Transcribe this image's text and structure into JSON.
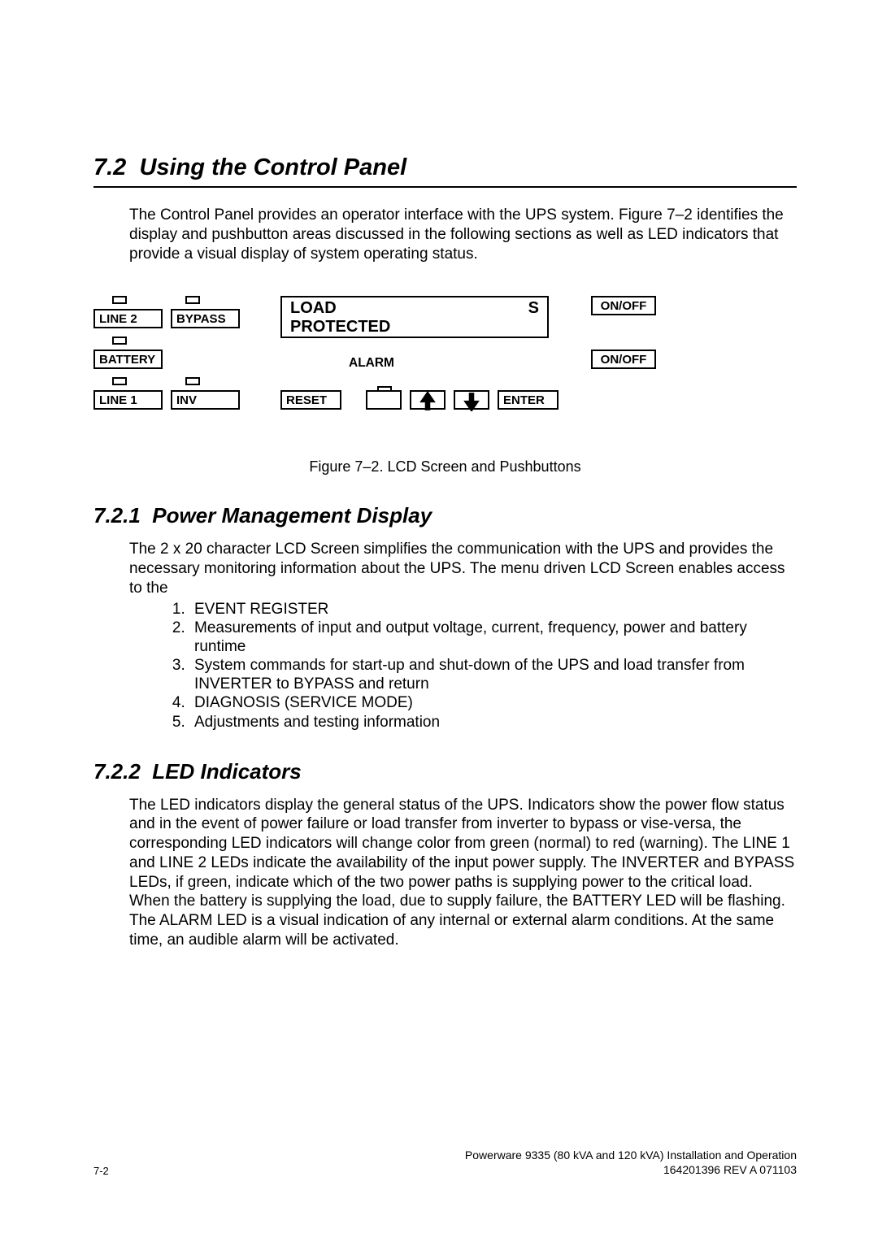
{
  "section_number": "7.2",
  "section_title": "Using the Control Panel",
  "intro": "The Control Panel provides an operator interface with the UPS system.  Figure 7–2 identifies the display and pushbutton areas discussed in the following sections as well as LED indicators that provide a visual display of system operating status.",
  "panel": {
    "line2": "LINE 2",
    "bypass": "BYPASS",
    "battery": "BATTERY",
    "line1": "LINE 1",
    "inv": "INV",
    "lcd_line1_left": "LOAD",
    "lcd_line1_right": "S",
    "lcd_line2": "PROTECTED",
    "alarm": "ALARM",
    "reset": "RESET",
    "enter": "ENTER",
    "onoff1": "ON/OFF",
    "onoff2": "ON/OFF"
  },
  "caption": "Figure 7–2.  LCD Screen and Pushbuttons",
  "sub1_number": "7.2.1",
  "sub1_title": "Power Management Display",
  "sub1_para": "The 2 x 20 character LCD Screen simplifies the communication with the UPS and provides the necessary monitoring information about the UPS.  The menu driven LCD Screen enables access to the",
  "sub1_list": {
    "i1": "EVENT REGISTER",
    "i2": "Measurements of input and output voltage, current, frequency, power and battery runtime",
    "i3": "System commands for start-up and shut-down of the UPS and load transfer from INVERTER to BYPASS and return",
    "i4": "DIAGNOSIS (SERVICE MODE)",
    "i5": "Adjustments and testing information"
  },
  "sub2_number": "7.2.2",
  "sub2_title": "LED Indicators",
  "sub2_para": "The LED indicators display the general status of the UPS.  Indicators show the power flow status and in the event of power failure or load transfer from inverter to bypass or vise-versa, the corresponding LED indicators will change color from green (normal) to red (warning). The LINE 1 and LINE 2 LEDs indicate the availability of the input power supply.  The INVERTER and BYPASS LEDs, if green, indicate which of the two power paths is supplying power to the critical load.  When the battery is supplying the load, due to supply failure, the BATTERY LED will be flashing.  The ALARM LED is a visual indication of any internal or external alarm conditions.  At the same time, an audible alarm will be activated.",
  "footer": {
    "page": "7-2",
    "line1": "Powerware 9335 (80 kVA and 120 kVA) Installation and Operation",
    "line2": "164201396 REV A  071103"
  }
}
